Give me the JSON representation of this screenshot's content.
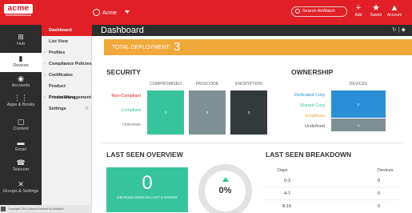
{
  "topbar": {
    "logo": "acme",
    "tenant": "Acme",
    "search_placeholder": "Search AirWatch",
    "actions": [
      {
        "label": "Add",
        "icon": "plus-icon",
        "glyph": "+"
      },
      {
        "label": "Saved",
        "icon": "star-icon",
        "glyph": "★"
      },
      {
        "label": "Account",
        "icon": "user-icon",
        "glyph": "▲"
      }
    ]
  },
  "rail": {
    "items": [
      {
        "label": "Hub",
        "icon": "hub-icon",
        "glyph": "⊞"
      },
      {
        "label": "Devices",
        "icon": "device-icon",
        "glyph": "▮"
      },
      {
        "label": "Accounts",
        "icon": "accounts-icon",
        "glyph": "◉"
      },
      {
        "label": "Apps & Books",
        "icon": "apps-icon",
        "glyph": "⋮⋮"
      },
      {
        "label": "Content",
        "icon": "content-icon",
        "glyph": "▢"
      },
      {
        "label": "Email",
        "icon": "email-icon",
        "glyph": "▬"
      },
      {
        "label": "Telecom",
        "icon": "phone-icon",
        "glyph": "☎"
      },
      {
        "label": "Groups & Settings",
        "icon": "wrench-icon",
        "glyph": "✕"
      }
    ],
    "footer": "Copyright 2016 | About    Powered by AirWatch"
  },
  "menu": {
    "items": [
      {
        "label": "Dashboard",
        "active": true
      },
      {
        "label": "List View"
      },
      {
        "label": "Profiles"
      },
      {
        "label": "Compliance Policies"
      },
      {
        "label": "Certificates"
      },
      {
        "label": "Product Provisioning"
      },
      {
        "label": "Printer Management"
      },
      {
        "label": "Settings"
      }
    ]
  },
  "main": {
    "title": "Dashboard",
    "deployment_label": "TOTAL DEPLOYMENT:",
    "deployment_value": "3",
    "security": {
      "title": "SECURITY",
      "columns": [
        "COMPROMISED",
        "PASSCODE",
        "ENCRYPTION"
      ],
      "rows": [
        "Non-Compliant",
        "Compliant",
        "Unknown"
      ],
      "tile_values": [
        "3",
        "3",
        "3"
      ]
    },
    "ownership": {
      "title": "OWNERSHIP",
      "column": "DEVICES",
      "rows": [
        "Dedicated Corp",
        "Shared Corp",
        "Employee",
        "Undefined"
      ],
      "values": [
        "2",
        "1"
      ]
    },
    "last_seen_overview": {
      "title": "LAST SEEN OVERVIEW",
      "value": "0",
      "caption": "DEVICES SEEN IN LAST 6 HOURS",
      "percent": "0%"
    },
    "last_seen_breakdown": {
      "title": "LAST SEEN BREAKDOWN",
      "headers": [
        "Days",
        "Devices"
      ],
      "rows": [
        {
          "days": "0-3",
          "devices": "0"
        },
        {
          "days": "4-7",
          "devices": "0"
        },
        {
          "days": "8-15",
          "devices": "0"
        }
      ]
    }
  },
  "colors": {
    "brand_red": "#e01f26",
    "deploy_orange": "#f0a83a",
    "teal": "#37c49c",
    "blue": "#2b8fd6",
    "gray_tile": "#7f9095",
    "dark_tile": "#333a3c"
  }
}
